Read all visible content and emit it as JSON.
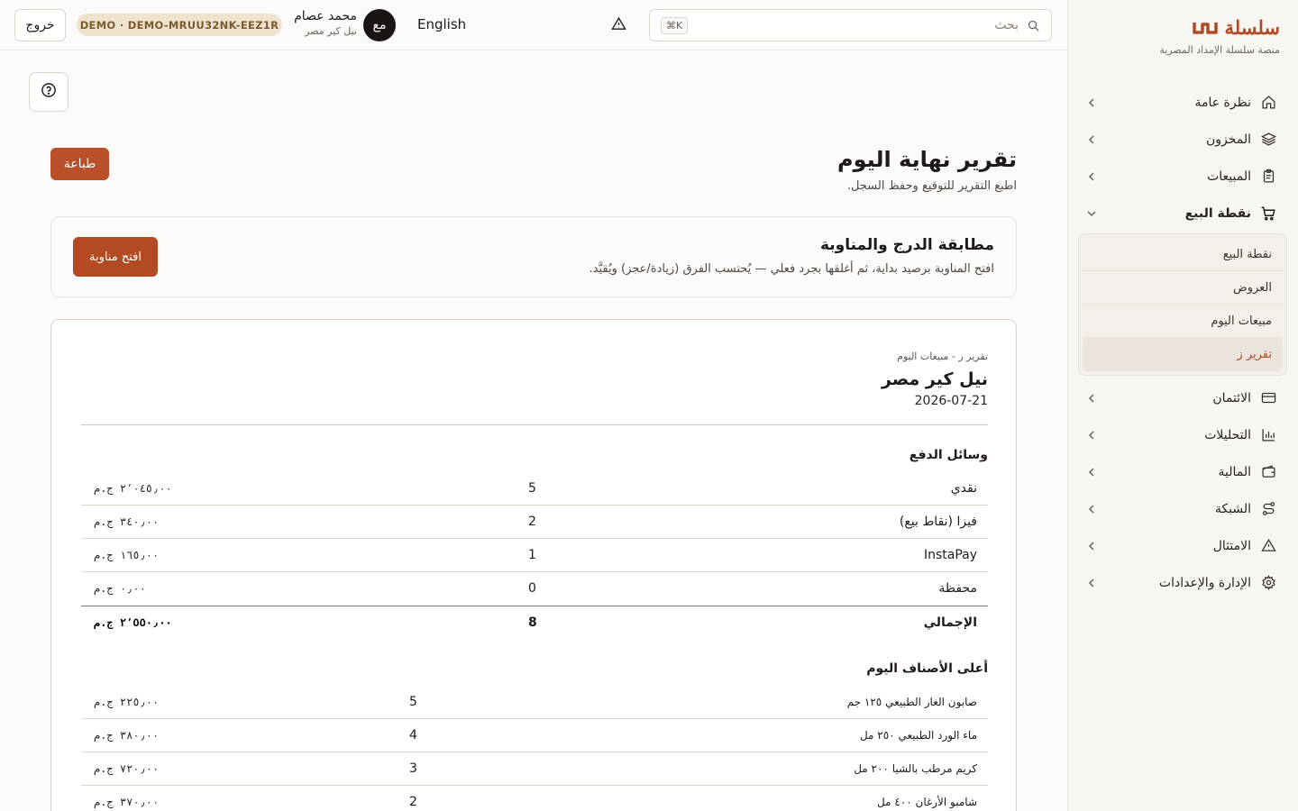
{
  "brand": {
    "name": "سلسلة",
    "subtitle": "منصة سلسلة الإمداد المصرية",
    "accent": "#b04a24"
  },
  "topbar": {
    "search_placeholder": "بحث",
    "shortcut": "⌘K",
    "language": "English",
    "avatar_initials": "مع",
    "user_name": "محمد عصام",
    "user_org": "نيل كير مصر",
    "demo_badge": "DEMO · DEMO-MRUU32NK-EEZ1R",
    "logout": "خروج"
  },
  "sidebar": {
    "items": [
      {
        "label": "نظرة عامة",
        "icon": "home-icon"
      },
      {
        "label": "المخزون",
        "icon": "layers-icon"
      },
      {
        "label": "المبيعات",
        "icon": "clipboard-icon"
      },
      {
        "label": "نقطة البيع",
        "icon": "cart-icon",
        "expanded": true
      },
      {
        "label": "الائتمان",
        "icon": "credit-card-icon"
      },
      {
        "label": "التحليلات",
        "icon": "bar-chart-icon"
      },
      {
        "label": "المالية",
        "icon": "wallet-icon"
      },
      {
        "label": "الشبكة",
        "icon": "route-icon"
      },
      {
        "label": "الامتثال",
        "icon": "warning-icon"
      },
      {
        "label": "الإدارة والإعدادات",
        "icon": "gear-icon"
      }
    ],
    "pos_subitems": [
      {
        "label": "نقطة البيع"
      },
      {
        "label": "العروض"
      },
      {
        "label": "مبيعات اليوم"
      },
      {
        "label": "تقرير ز",
        "current": true
      }
    ]
  },
  "page": {
    "title": "تقرير نهاية اليوم",
    "subtitle": "اطبع التقرير للتوقيع وحفظ السجل.",
    "print": "طباعة"
  },
  "reconciliation": {
    "title": "مطابقة الدرج والمناوبة",
    "description": "افتح المناوبة برصيد بداية، ثم أغلقها بجرد فعلي — يُحتسب الفرق (زيادة/عجز) ويُقيَّد.",
    "open_shift": "افتح مناوبة"
  },
  "report": {
    "kicker": "تقرير ز - مبيعات اليوم",
    "store": "نيل كير مصر",
    "date": "2026-07-21",
    "payments_title": "وسائل الدفع",
    "payments": [
      {
        "method": "نقدي",
        "count": "5",
        "amount": "٢٬٠٤٥٫٠٠ ج.م"
      },
      {
        "method": "فيزا (نقاط بيع)",
        "count": "2",
        "amount": "٣٤٠٫٠٠ ج.م"
      },
      {
        "method": "InstaPay",
        "count": "1",
        "amount": "١٦٥٫٠٠ ج.م"
      },
      {
        "method": "محفظة",
        "count": "0",
        "amount": "٠٫٠٠ ج.م"
      }
    ],
    "total": {
      "label": "الإجمالي",
      "count": "8",
      "amount": "٢٬٥٥٠٫٠٠ ج.م"
    },
    "top_title": "أعلى الأصناف اليوم",
    "top_items": [
      {
        "name": "صابون الغار الطبيعي ١٢٥ جم",
        "qty": "5",
        "amount": "٢٢٥٫٠٠ ج.م"
      },
      {
        "name": "ماء الورد الطبيعي ٢٥٠ مل",
        "qty": "4",
        "amount": "٣٨٠٫٠٠ ج.م"
      },
      {
        "name": "كريم مرطب بالشيا ٢٠٠ مل",
        "qty": "3",
        "amount": "٧٢٠٫٠٠ ج.م"
      },
      {
        "name": "شامبو الأرغان ٤٠٠ مل",
        "qty": "2",
        "amount": "٣٧٠٫٠٠ ج.م"
      }
    ]
  }
}
